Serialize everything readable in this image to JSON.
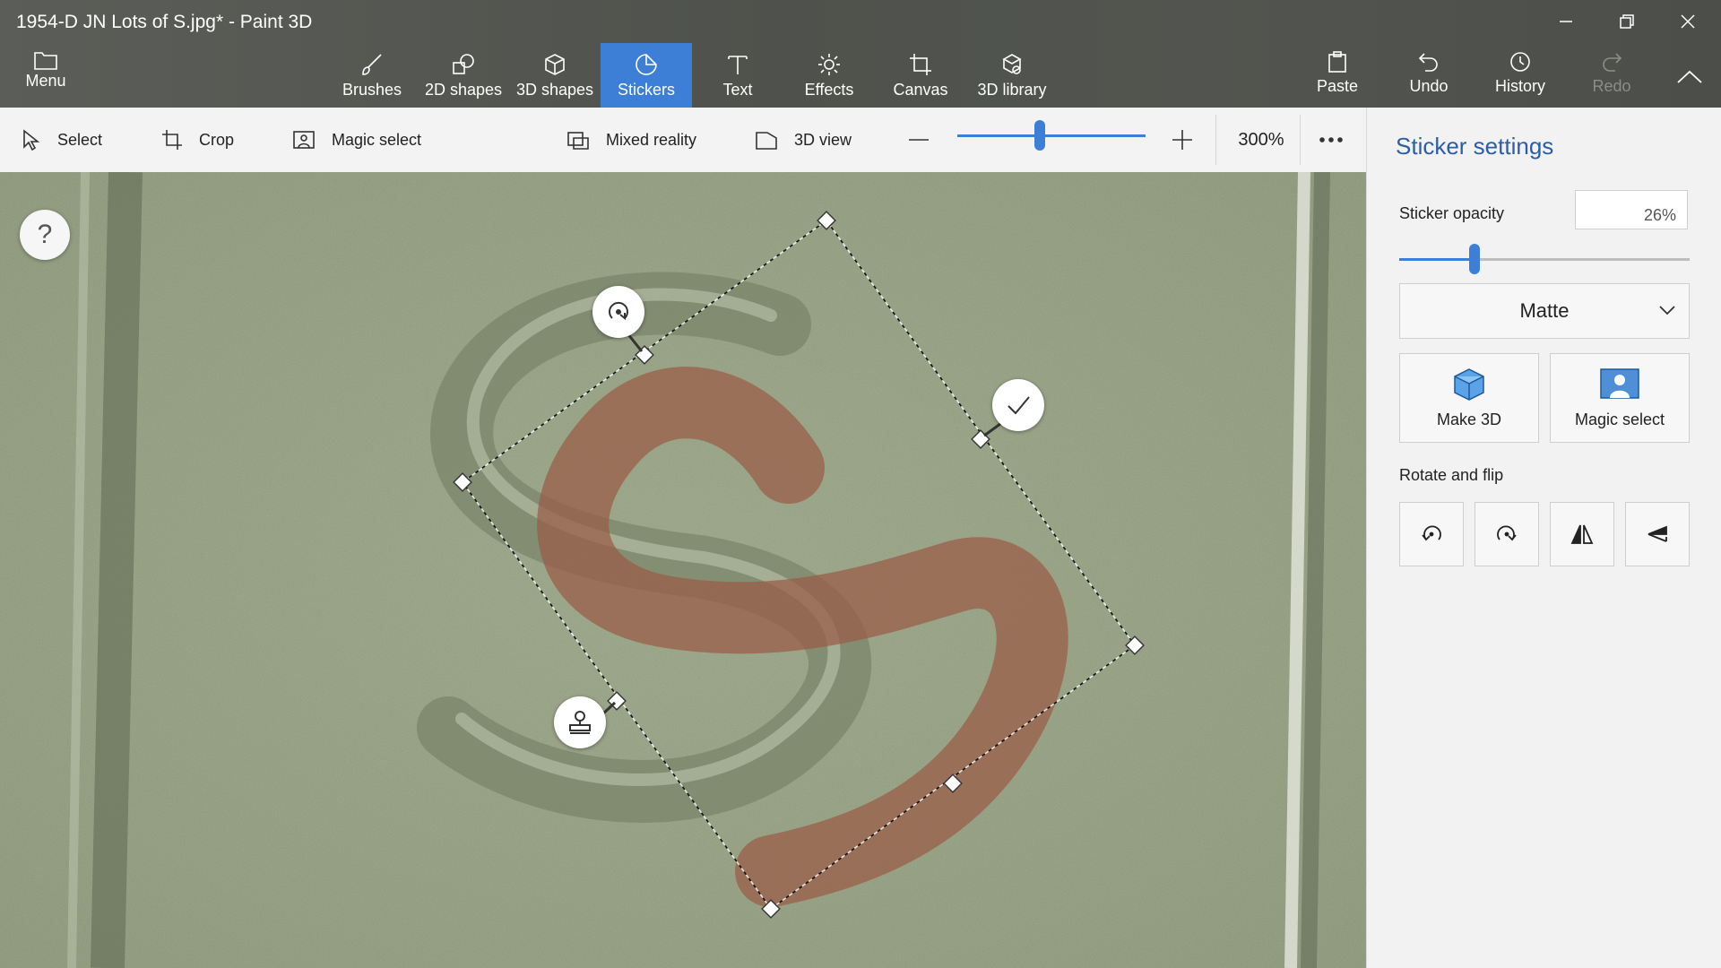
{
  "window": {
    "title": "1954-D JN Lots of S.jpg* - Paint 3D"
  },
  "menu": {
    "label": "Menu"
  },
  "tabs": [
    {
      "label": "Brushes",
      "icon": "brush-icon"
    },
    {
      "label": "2D shapes",
      "icon": "2d-shapes-icon"
    },
    {
      "label": "3D shapes",
      "icon": "3d-shapes-icon"
    },
    {
      "label": "Stickers",
      "icon": "stickers-icon",
      "active": true
    },
    {
      "label": "Text",
      "icon": "text-icon"
    },
    {
      "label": "Effects",
      "icon": "effects-icon"
    },
    {
      "label": "Canvas",
      "icon": "canvas-icon"
    },
    {
      "label": "3D library",
      "icon": "3d-library-icon"
    }
  ],
  "actions": {
    "paste": "Paste",
    "undo": "Undo",
    "history": "History",
    "redo": "Redo"
  },
  "toolbar": {
    "select": "Select",
    "crop": "Crop",
    "magic_select": "Magic select",
    "mixed_reality": "Mixed reality",
    "view_3d": "3D view",
    "zoom": "300%",
    "zoom_slider_fraction": 0.44
  },
  "canvas": {
    "help": "?"
  },
  "panel": {
    "title": "Sticker settings",
    "opacity_label": "Sticker opacity",
    "opacity_value": "26%",
    "opacity_fraction": 0.26,
    "finish": "Matte",
    "make_3d": "Make 3D",
    "magic_select": "Magic select",
    "rotate_label": "Rotate and flip"
  },
  "colors": {
    "accent": "#3d7fd6",
    "topbar": "#52554f",
    "panel_title": "#2a5ea8",
    "sticker": "#9a5c46"
  }
}
